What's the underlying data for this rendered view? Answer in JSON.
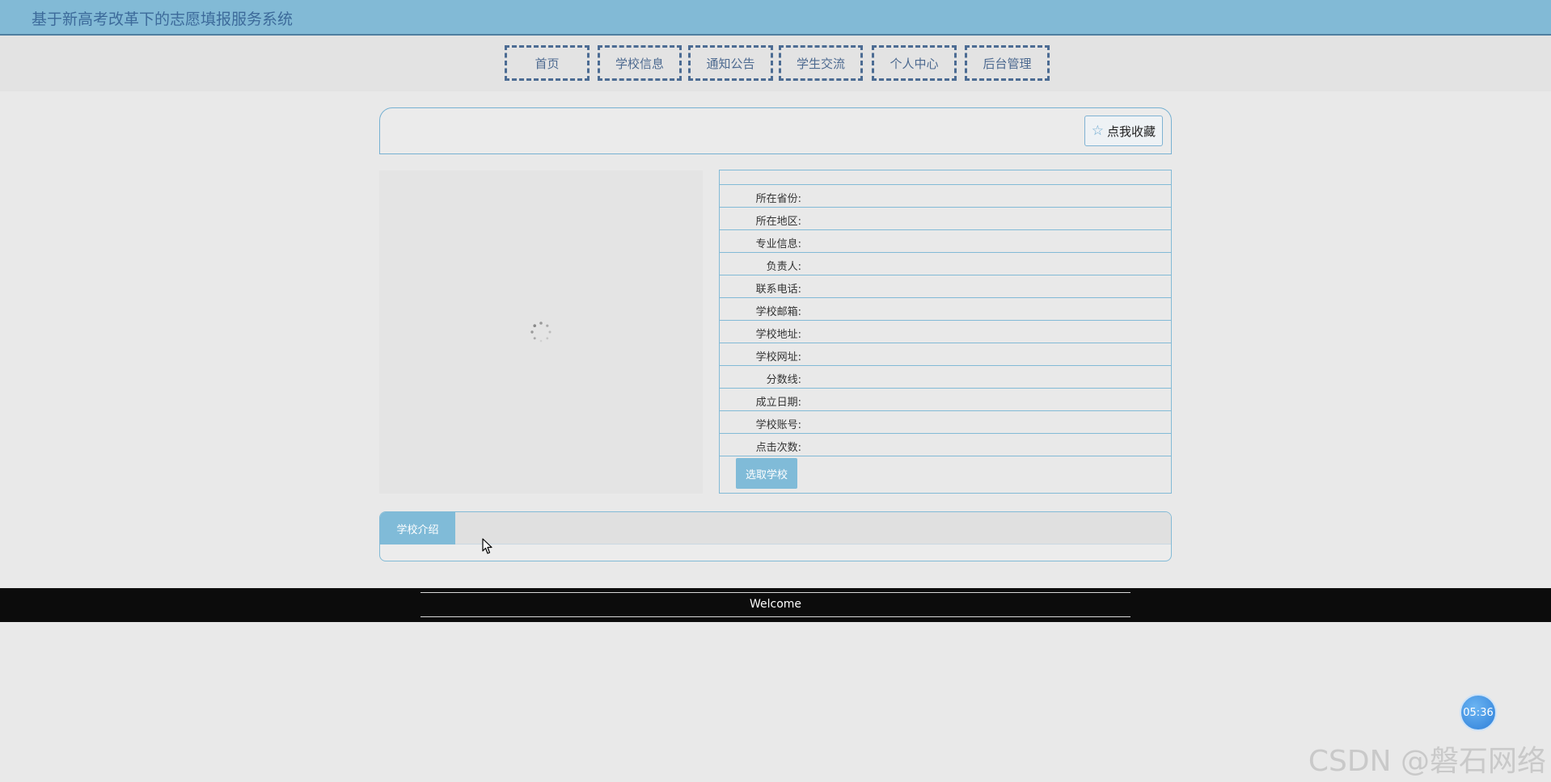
{
  "header": {
    "title": "基于新高考改革下的志愿填报服务系统"
  },
  "nav": {
    "items": [
      {
        "label": "首页"
      },
      {
        "label": "学校信息"
      },
      {
        "label": "通知公告"
      },
      {
        "label": "学生交流"
      },
      {
        "label": "个人中心"
      },
      {
        "label": "后台管理"
      }
    ]
  },
  "favorite": {
    "label": "点我收藏",
    "icon": "star-icon"
  },
  "school_info": {
    "title": "",
    "fields": [
      {
        "label": "所在省份:",
        "value": ""
      },
      {
        "label": "所在地区:",
        "value": ""
      },
      {
        "label": "专业信息:",
        "value": ""
      },
      {
        "label": "负责人:",
        "value": ""
      },
      {
        "label": "联系电话:",
        "value": ""
      },
      {
        "label": "学校邮箱:",
        "value": ""
      },
      {
        "label": "学校地址:",
        "value": ""
      },
      {
        "label": "学校网址:",
        "value": ""
      },
      {
        "label": "分数线:",
        "value": ""
      },
      {
        "label": "成立日期:",
        "value": ""
      },
      {
        "label": "学校账号:",
        "value": ""
      },
      {
        "label": "点击次数:",
        "value": ""
      }
    ],
    "select_button": "选取学校"
  },
  "intro": {
    "tab_label": "学校介绍"
  },
  "footer": {
    "text": "Welcome"
  },
  "timer": {
    "text": "05:36"
  },
  "watermark": {
    "text": "CSDN @磐石网络"
  },
  "colors": {
    "header_bg": "#82bad6",
    "accent": "#80bbd8",
    "nav_border": "#4c6c93",
    "footer_bg": "#0c0c0c"
  }
}
